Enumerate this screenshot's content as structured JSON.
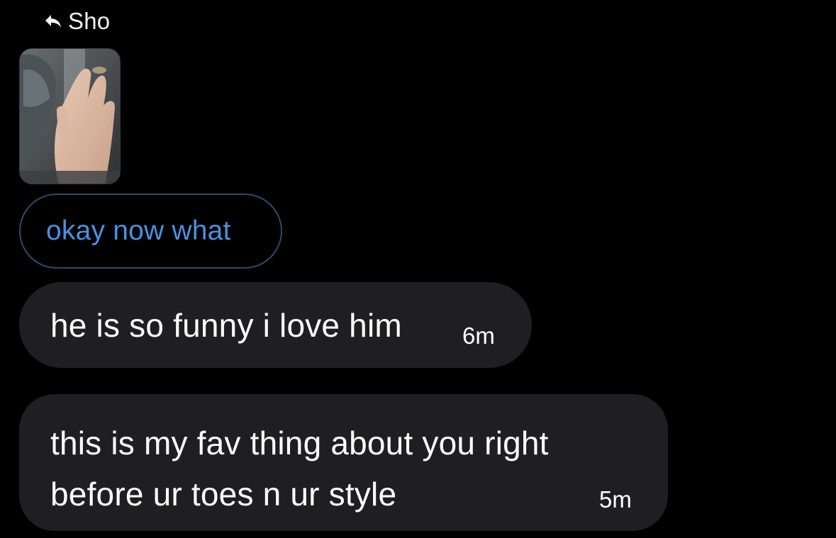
{
  "reply_header": {
    "icon": "reply-arrow-icon",
    "name": "Sho"
  },
  "shared_media": {
    "type": "photo-thumbnail"
  },
  "quoted_message": {
    "text": "okay now what",
    "color": "#4a90e2"
  },
  "messages": [
    {
      "text": "he is so funny i love him",
      "time": "6m"
    },
    {
      "text": "this is my fav thing about you right before ur toes n ur style",
      "time": "5m"
    }
  ],
  "colors": {
    "background": "#000000",
    "bubble": "#1f1f22",
    "quote_border": "#2f4a6c",
    "text": "#ffffff"
  }
}
